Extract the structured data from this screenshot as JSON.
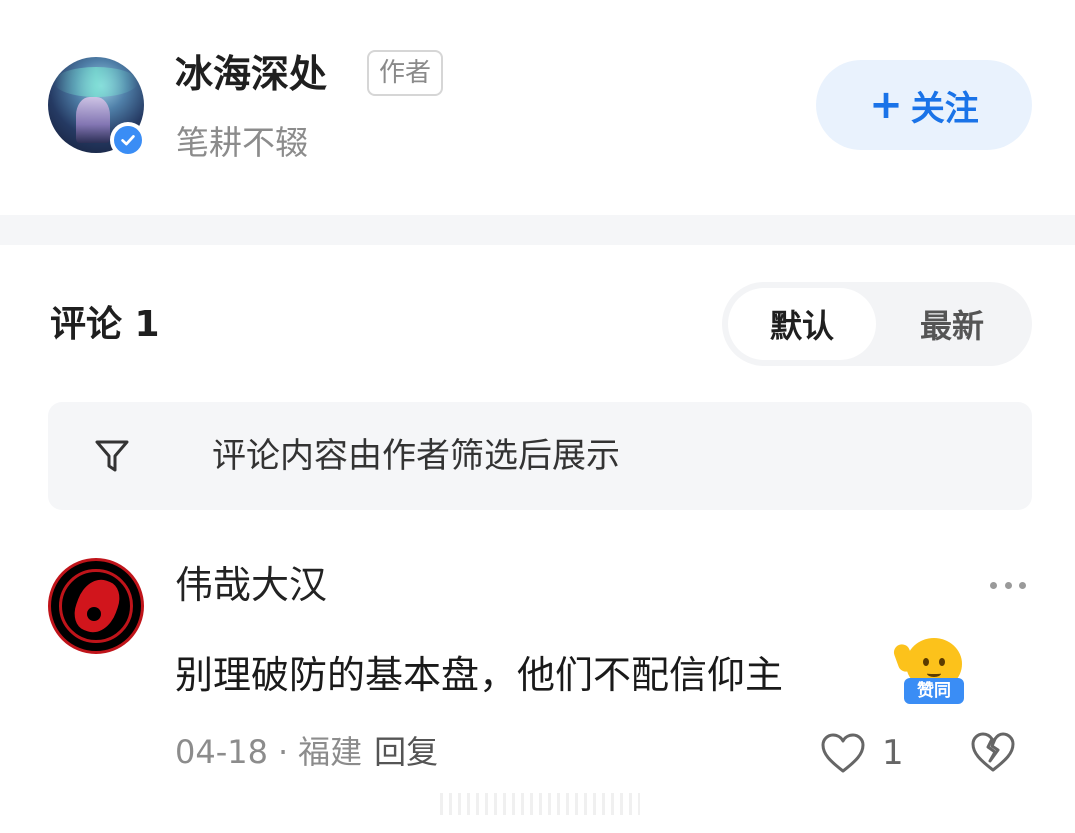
{
  "author": {
    "name": "冰海深处",
    "tag": "作者",
    "subtitle": "笔耕不辍",
    "follow_label": "关注",
    "follow_plus": "+",
    "verified": true
  },
  "comments_header": {
    "title": "评论 1",
    "sort_options": [
      "默认",
      "最新"
    ],
    "active_sort": "默认"
  },
  "filter_notice": {
    "text": "评论内容由作者筛选后展示"
  },
  "comment": {
    "user": "伟哉大汉",
    "text": "别理破防的基本盘，他们不配信仰主",
    "sticker_label": "赞同",
    "date": "04-18",
    "separator": "·",
    "location": "福建",
    "reply_label": "回复",
    "like_count": "1"
  },
  "colors": {
    "accent": "#1a73e8",
    "follow_bg": "#e9f2fd",
    "verified": "#3a8df5",
    "muted": "#8c8c8c"
  },
  "icons": [
    "verified-icon",
    "filter-icon",
    "more-icon",
    "like-icon",
    "dislike-icon"
  ]
}
